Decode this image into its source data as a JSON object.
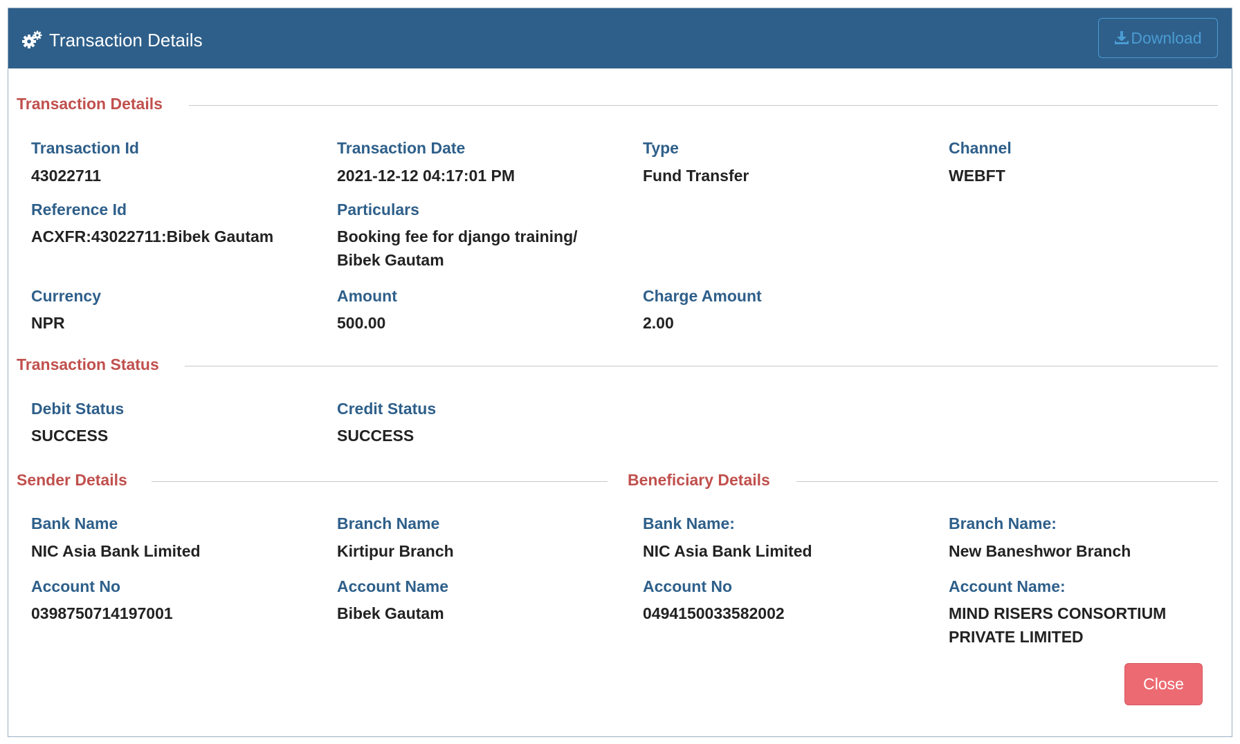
{
  "header": {
    "title": "Transaction Details",
    "icon": "gears-icon",
    "download_label": "Download"
  },
  "transaction": {
    "section_title": "Transaction Details",
    "transaction_id": {
      "label": "Transaction Id",
      "value": "43022711"
    },
    "transaction_date": {
      "label": "Transaction Date",
      "value": "2021-12-12 04:17:01 PM"
    },
    "type": {
      "label": "Type",
      "value": "Fund Transfer"
    },
    "channel": {
      "label": "Channel",
      "value": "WEBFT"
    },
    "reference_id": {
      "label": "Reference Id",
      "value": "ACXFR:43022711:Bibek Gautam"
    },
    "particulars": {
      "label": "Particulars",
      "value": "Booking fee for django training/ Bibek Gautam"
    },
    "currency": {
      "label": "Currency",
      "value": "NPR"
    },
    "amount": {
      "label": "Amount",
      "value": "500.00"
    },
    "charge_amount": {
      "label": "Charge Amount",
      "value": "2.00"
    }
  },
  "status": {
    "section_title": "Transaction Status",
    "debit_status": {
      "label": "Debit Status",
      "value": "SUCCESS"
    },
    "credit_status": {
      "label": "Credit Status",
      "value": "SUCCESS"
    }
  },
  "sender": {
    "section_title": "Sender Details",
    "bank_name": {
      "label": "Bank Name",
      "value": "NIC Asia Bank Limited"
    },
    "branch_name": {
      "label": "Branch Name",
      "value": "Kirtipur Branch"
    },
    "account_no": {
      "label": "Account No",
      "value": "0398750714197001"
    },
    "account_name": {
      "label": "Account Name",
      "value": "Bibek Gautam"
    }
  },
  "beneficiary": {
    "section_title": "Beneficiary Details",
    "bank_name": {
      "label": "Bank Name:",
      "value": "NIC Asia Bank Limited"
    },
    "branch_name": {
      "label": "Branch Name:",
      "value": "New Baneshwor Branch"
    },
    "account_no": {
      "label": "Account No",
      "value": "0494150033582002"
    },
    "account_name": {
      "label": "Account Name:",
      "value": "MIND RISERS CONSORTIUM PRIVATE LIMITED"
    }
  },
  "footer": {
    "close_label": "Close"
  },
  "colors": {
    "header_bg": "#2e5f8a",
    "section_title": "#c0504d",
    "label": "#2e5f8a",
    "close_button": "#ec6b72",
    "download_border": "#4b9cd3"
  }
}
